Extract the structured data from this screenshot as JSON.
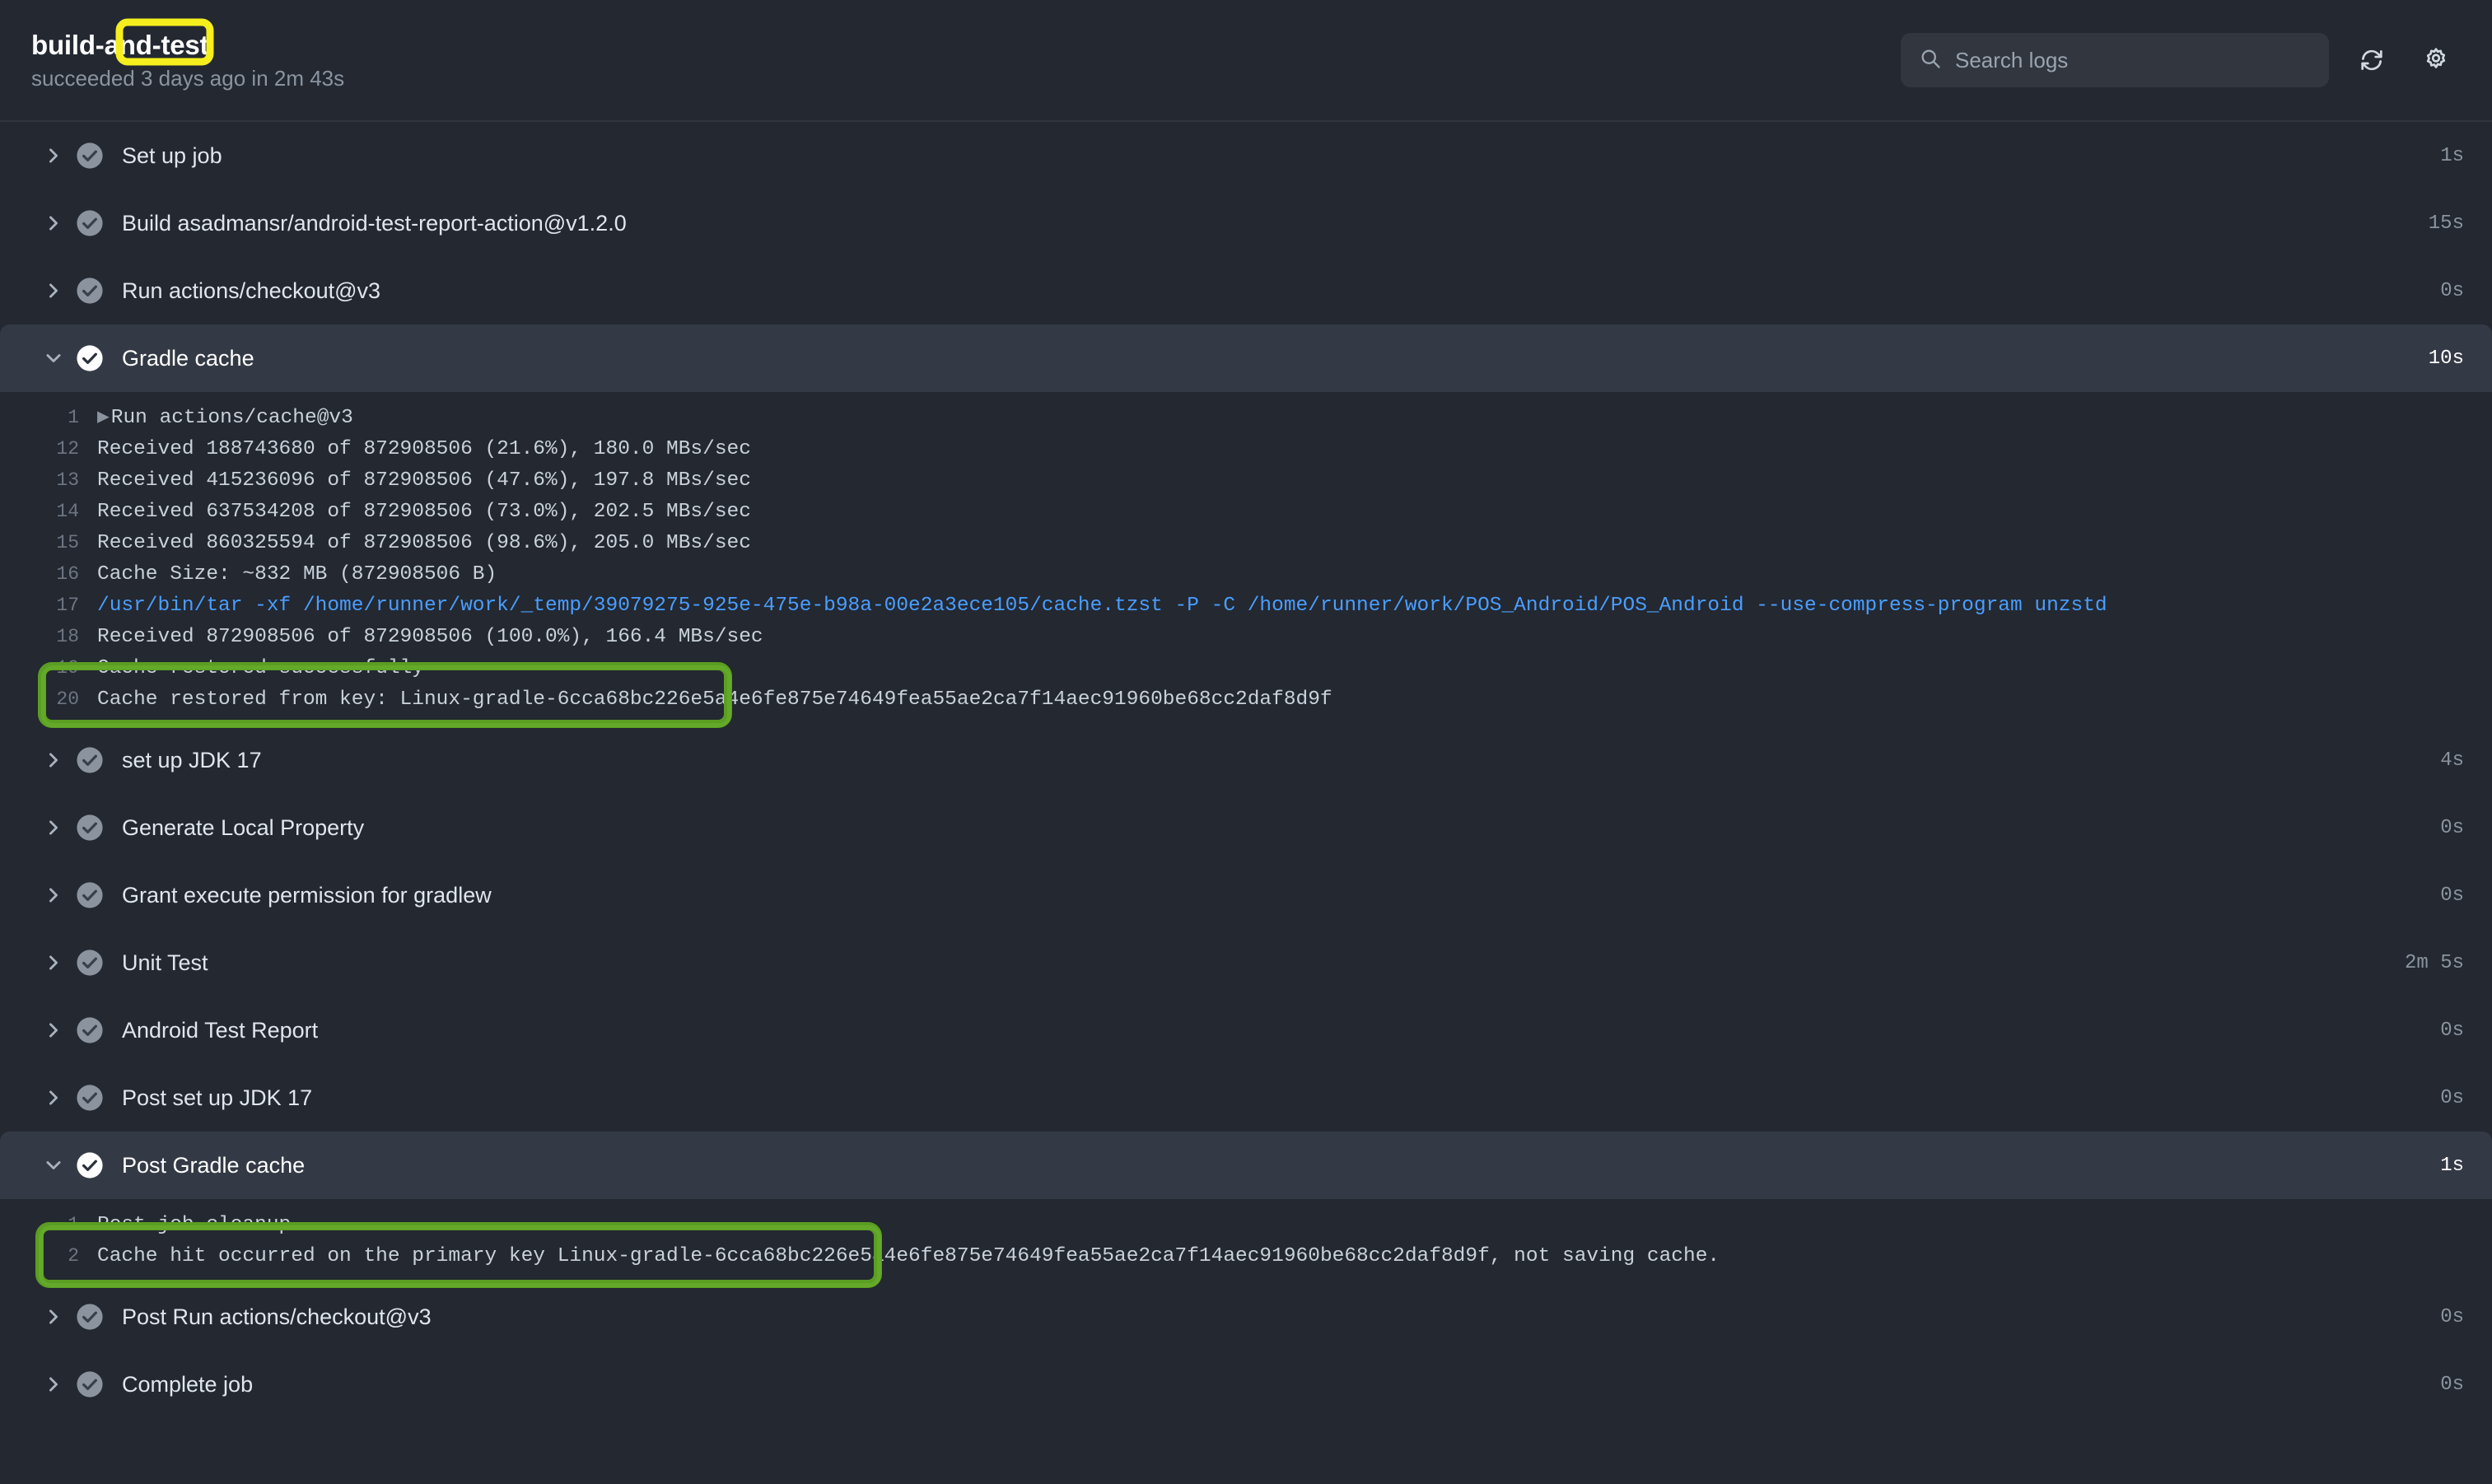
{
  "header": {
    "job_title": "build-and-test",
    "status_line": "succeeded 3 days ago in 2m 43s",
    "search_placeholder": "Search logs",
    "search_value": "",
    "refresh_icon": "refresh-icon",
    "settings_icon": "gear-icon",
    "search_icon": "search-icon"
  },
  "colors": {
    "background": "#232831",
    "row_expanded": "#343a45",
    "accent_blue": "#4a9eff",
    "annotation_yellow": "#f5ee1e",
    "annotation_green": "#5a9e22",
    "text_primary": "#e0e6ed",
    "text_muted": "#8b949e"
  },
  "steps": [
    {
      "label": "Set up job",
      "duration": "1s",
      "expanded": false,
      "status": "success"
    },
    {
      "label": "Build asadmansr/android-test-report-action@v1.2.0",
      "duration": "15s",
      "expanded": false,
      "status": "success"
    },
    {
      "label": "Run actions/checkout@v3",
      "duration": "0s",
      "expanded": false,
      "status": "success"
    },
    {
      "label": "Gradle cache",
      "duration": "10s",
      "expanded": true,
      "status": "success"
    },
    {
      "label": "set up JDK 17",
      "duration": "4s",
      "expanded": false,
      "status": "success"
    },
    {
      "label": "Generate Local Property",
      "duration": "0s",
      "expanded": false,
      "status": "success"
    },
    {
      "label": "Grant execute permission for gradlew",
      "duration": "0s",
      "expanded": false,
      "status": "success"
    },
    {
      "label": "Unit Test",
      "duration": "2m 5s",
      "expanded": false,
      "status": "success"
    },
    {
      "label": "Android Test Report",
      "duration": "0s",
      "expanded": false,
      "status": "success"
    },
    {
      "label": "Post set up JDK 17",
      "duration": "0s",
      "expanded": false,
      "status": "success"
    },
    {
      "label": "Post Gradle cache",
      "duration": "1s",
      "expanded": true,
      "status": "success"
    },
    {
      "label": "Post Run actions/checkout@v3",
      "duration": "0s",
      "expanded": false,
      "status": "success"
    },
    {
      "label": "Complete job",
      "duration": "0s",
      "expanded": false,
      "status": "success"
    }
  ],
  "gradle_cache_log": [
    {
      "num": "1",
      "text": "Run actions/cache@v3",
      "style": "normal",
      "triangle": true
    },
    {
      "num": "12",
      "text": "Received 188743680 of 872908506 (21.6%), 180.0 MBs/sec",
      "style": "normal",
      "triangle": false
    },
    {
      "num": "13",
      "text": "Received 415236096 of 872908506 (47.6%), 197.8 MBs/sec",
      "style": "normal",
      "triangle": false
    },
    {
      "num": "14",
      "text": "Received 637534208 of 872908506 (73.0%), 202.5 MBs/sec",
      "style": "normal",
      "triangle": false
    },
    {
      "num": "15",
      "text": "Received 860325594 of 872908506 (98.6%), 205.0 MBs/sec",
      "style": "normal",
      "triangle": false
    },
    {
      "num": "16",
      "text": "Cache Size: ~832 MB (872908506 B)",
      "style": "normal",
      "triangle": false
    },
    {
      "num": "17",
      "text": "/usr/bin/tar -xf /home/runner/work/_temp/39079275-925e-475e-b98a-00e2a3ece105/cache.tzst -P -C /home/runner/work/POS_Android/POS_Android --use-compress-program unzstd",
      "style": "blue",
      "triangle": false
    },
    {
      "num": "18",
      "text": "Received 872908506 of 872908506 (100.0%), 166.4 MBs/sec",
      "style": "normal",
      "triangle": false
    },
    {
      "num": "19",
      "text": "Cache restored successfully",
      "style": "normal",
      "triangle": false
    },
    {
      "num": "20",
      "text": "Cache restored from key: Linux-gradle-6cca68bc226e5a4e6fe875e74649fea55ae2ca7f14aec91960be68cc2daf8d9f",
      "style": "normal",
      "triangle": false
    }
  ],
  "post_gradle_cache_log": [
    {
      "num": "1",
      "text": "Post job cleanup.",
      "style": "normal",
      "triangle": false
    },
    {
      "num": "2",
      "text": "Cache hit occurred on the primary key Linux-gradle-6cca68bc226e5a4e6fe875e74649fea55ae2ca7f14aec91960be68cc2daf8d9f, not saving cache.",
      "style": "normal",
      "triangle": false
    }
  ]
}
